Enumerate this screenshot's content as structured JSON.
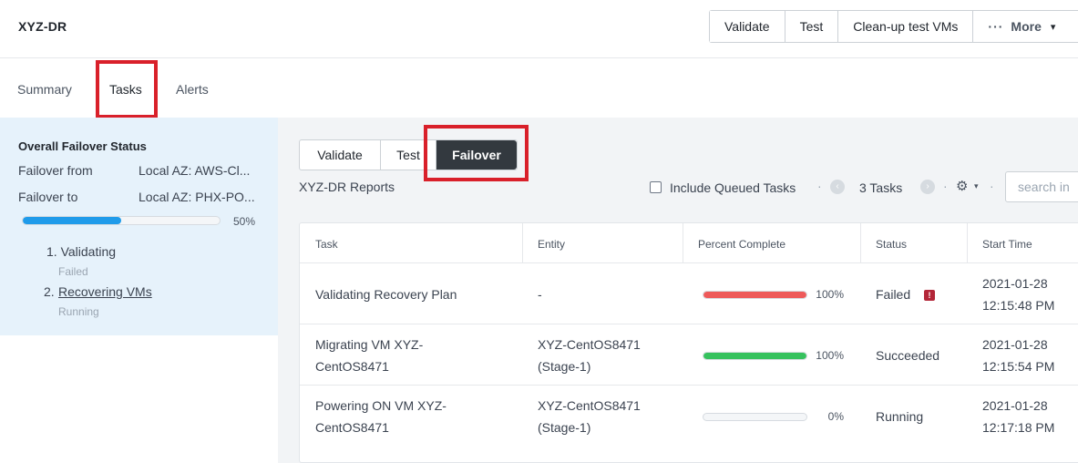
{
  "app": {
    "title": "XYZ-DR"
  },
  "toolbar": {
    "validate": "Validate",
    "test": "Test",
    "cleanup": "Clean-up test VMs",
    "more": "More"
  },
  "tabs": [
    {
      "label": "Summary"
    },
    {
      "label": "Tasks",
      "active": true
    },
    {
      "label": "Alerts"
    }
  ],
  "sidebar": {
    "title": "Overall Failover Status",
    "failover_from_label": "Failover from",
    "failover_from_value": "Local AZ: AWS-Cl...",
    "failover_to_label": "Failover to",
    "failover_to_value": "Local AZ: PHX-PO...",
    "progress": 0.5,
    "progress_text": "50%",
    "steps": [
      {
        "label": "1. Validating",
        "status": "Failed"
      },
      {
        "number": "2.",
        "label": "Recovering VMs",
        "status": "Running"
      }
    ]
  },
  "segment": {
    "validate": "Validate",
    "test": "Test",
    "failover": "Failover"
  },
  "reports": {
    "title": "XYZ-DR Reports",
    "include_queued_label": "Include Queued Tasks",
    "task_count": "3 Tasks",
    "search_placeholder": "search in"
  },
  "table": {
    "headers": [
      "Task",
      "Entity",
      "Percent Complete",
      "Status",
      "Start Time"
    ],
    "rows": [
      {
        "task_line1": "Validating Recovery Plan",
        "task_line2": "",
        "entity_line1": "-",
        "entity_line2": "",
        "percent": 1.0,
        "percent_text": "100%",
        "bar_color": "#ee5a5a",
        "status": "Failed",
        "date": "2021-01-28",
        "time": "12:15:48 PM"
      },
      {
        "task_line1": "Migrating VM XYZ-",
        "task_line2": "CentOS8471",
        "entity_line1": "XYZ-CentOS8471",
        "entity_line2": "(Stage-1)",
        "percent": 1.0,
        "percent_text": "100%",
        "bar_color": "#36c25e",
        "status": "Succeeded",
        "date": "2021-01-28",
        "time": "12:15:54 PM"
      },
      {
        "task_line1": "Powering ON VM XYZ-",
        "task_line2": "CentOS8471",
        "entity_line1": "XYZ-CentOS8471",
        "entity_line2": "(Stage-1)",
        "percent": 0.0,
        "percent_text": "0%",
        "bar_color": "#36c25e",
        "status": "Running",
        "date": "2021-01-28",
        "time": "12:17:18 PM"
      }
    ]
  },
  "icons": {
    "error_badge": "!",
    "gear": "⚙",
    "prev": "‹",
    "next": "›"
  },
  "colors": {
    "highlight": "#d9202a",
    "accent": "#1f9bea",
    "failed": "#b32638"
  }
}
